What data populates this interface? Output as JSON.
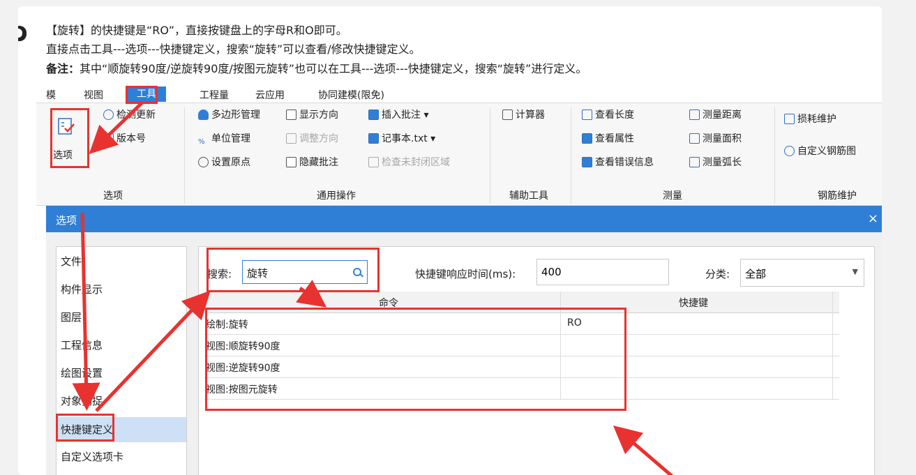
{
  "chat": {
    "line1": "【旋转】的快捷键是“RO”，直接按键盘上的字母R和O即可。",
    "line2": "直接点击工具---选项---快捷键定义，搜索“旋转”可以查看/修改快捷键定义。",
    "line3_bold": "备注：",
    "line3_rest": "其中“顺旋转90度/逆旋转90度/按图元旋转”也可以在工具---选项---快捷键定义，搜索“旋转”进行定义。"
  },
  "menu": {
    "item0": "模",
    "item1": "视图",
    "item2": "工具",
    "item3": "工程量",
    "item4": "云应用",
    "item5": "协同建模(限免)"
  },
  "ribbon": {
    "options_button": "选项",
    "check_update": "检测更新",
    "version": "版本号",
    "polygon_mgmt": "多边形管理",
    "show_direction": "显示方向",
    "insert_note": "插入批注",
    "unit_mgmt": "单位管理",
    "adjust_direction": "调整方向",
    "notepad": "记事本.txt",
    "set_origin": "设置原点",
    "hide_note": "隐藏批注",
    "check_unclosed": "检查未封闭区域",
    "calculator": "计算器",
    "view_length": "查看长度",
    "view_property": "查看属性",
    "view_error": "查看错误信息",
    "measure_distance": "测量距离",
    "measure_area": "测量面积",
    "measure_arc": "测量弧长",
    "loss_maintain": "损耗维护",
    "custom_rebar": "自定义钢筋图",
    "group_options": "选项",
    "group_common": "通用操作",
    "group_aux": "辅助工具",
    "group_measure": "测量",
    "group_rebar": "钢筋维护"
  },
  "dialog": {
    "title": "选项",
    "close": "×",
    "left_items": [
      "文件",
      "构件显示",
      "图层",
      "工程信息",
      "绘图设置",
      "对象捕捉",
      "快捷键定义",
      "自定义选项卡"
    ],
    "search_label": "搜索:",
    "search_value": "旋转",
    "response_label": "快捷键响应时间(ms):",
    "response_value": "400",
    "category_label": "分类:",
    "category_value": "全部",
    "col_command": "命令",
    "col_shortcut": "快捷键",
    "rows": [
      {
        "command": "绘制:旋转",
        "shortcut": "RO"
      },
      {
        "command": "视图:顺旋转90度",
        "shortcut": ""
      },
      {
        "command": "视图:逆旋转90度",
        "shortcut": ""
      },
      {
        "command": "视图:按图元旋转",
        "shortcut": ""
      }
    ]
  },
  "colors": {
    "accent": "#2f7fd6",
    "annotation": "#e8322f"
  }
}
